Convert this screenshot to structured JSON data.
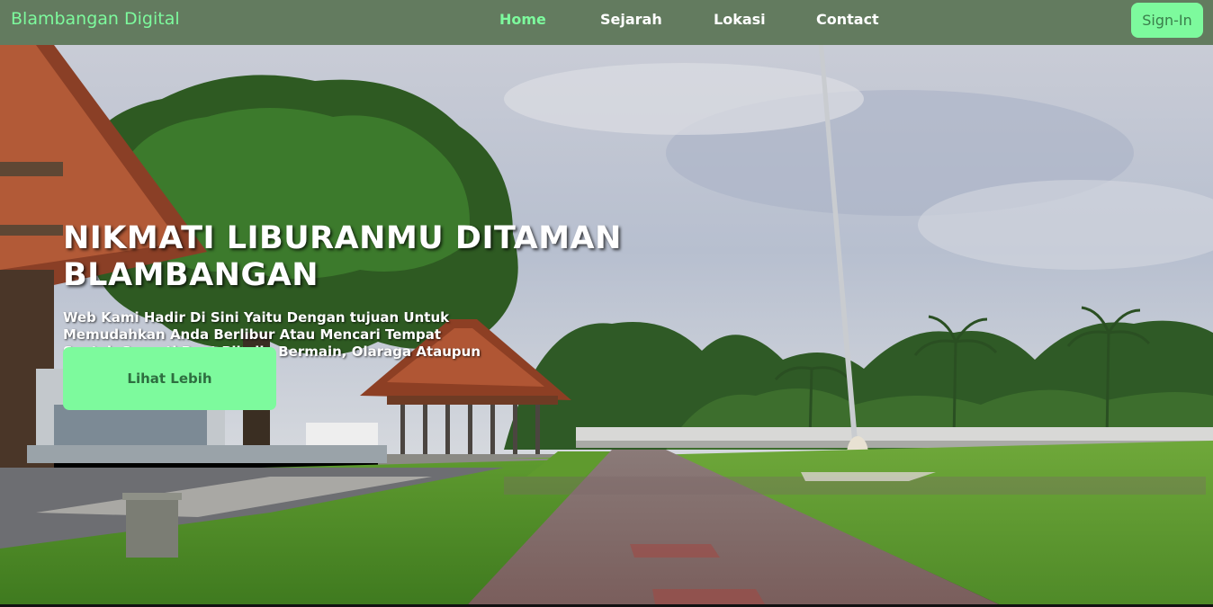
{
  "brand": {
    "name": "Blambangan Digital"
  },
  "nav": {
    "links": [
      {
        "label": "Home",
        "active": true
      },
      {
        "label": "Sejarah",
        "active": false
      },
      {
        "label": "Lokasi",
        "active": false
      },
      {
        "label": "Contact",
        "active": false
      }
    ],
    "signin_label": "Sign-In"
  },
  "hero": {
    "title": "NIKMATI LIBURANMU DITAMAN BLAMBANGAN",
    "subtitle": "Web Kami Hadir Di Sini Yaitu Dengan tujuan Untuk Memudahkan Anda Berlibur Atau Mencari Tempat Santai, Seperti Buat Piknik, Bermain, Olaraga Ataupun Kegiatan Lainnya",
    "cta_label": "Lihat Lebih",
    "background": "park-photo"
  },
  "colors": {
    "navbar_bg": "#637b5f",
    "accent": "#7dfa9d",
    "accent_text": "#2e6e40"
  }
}
